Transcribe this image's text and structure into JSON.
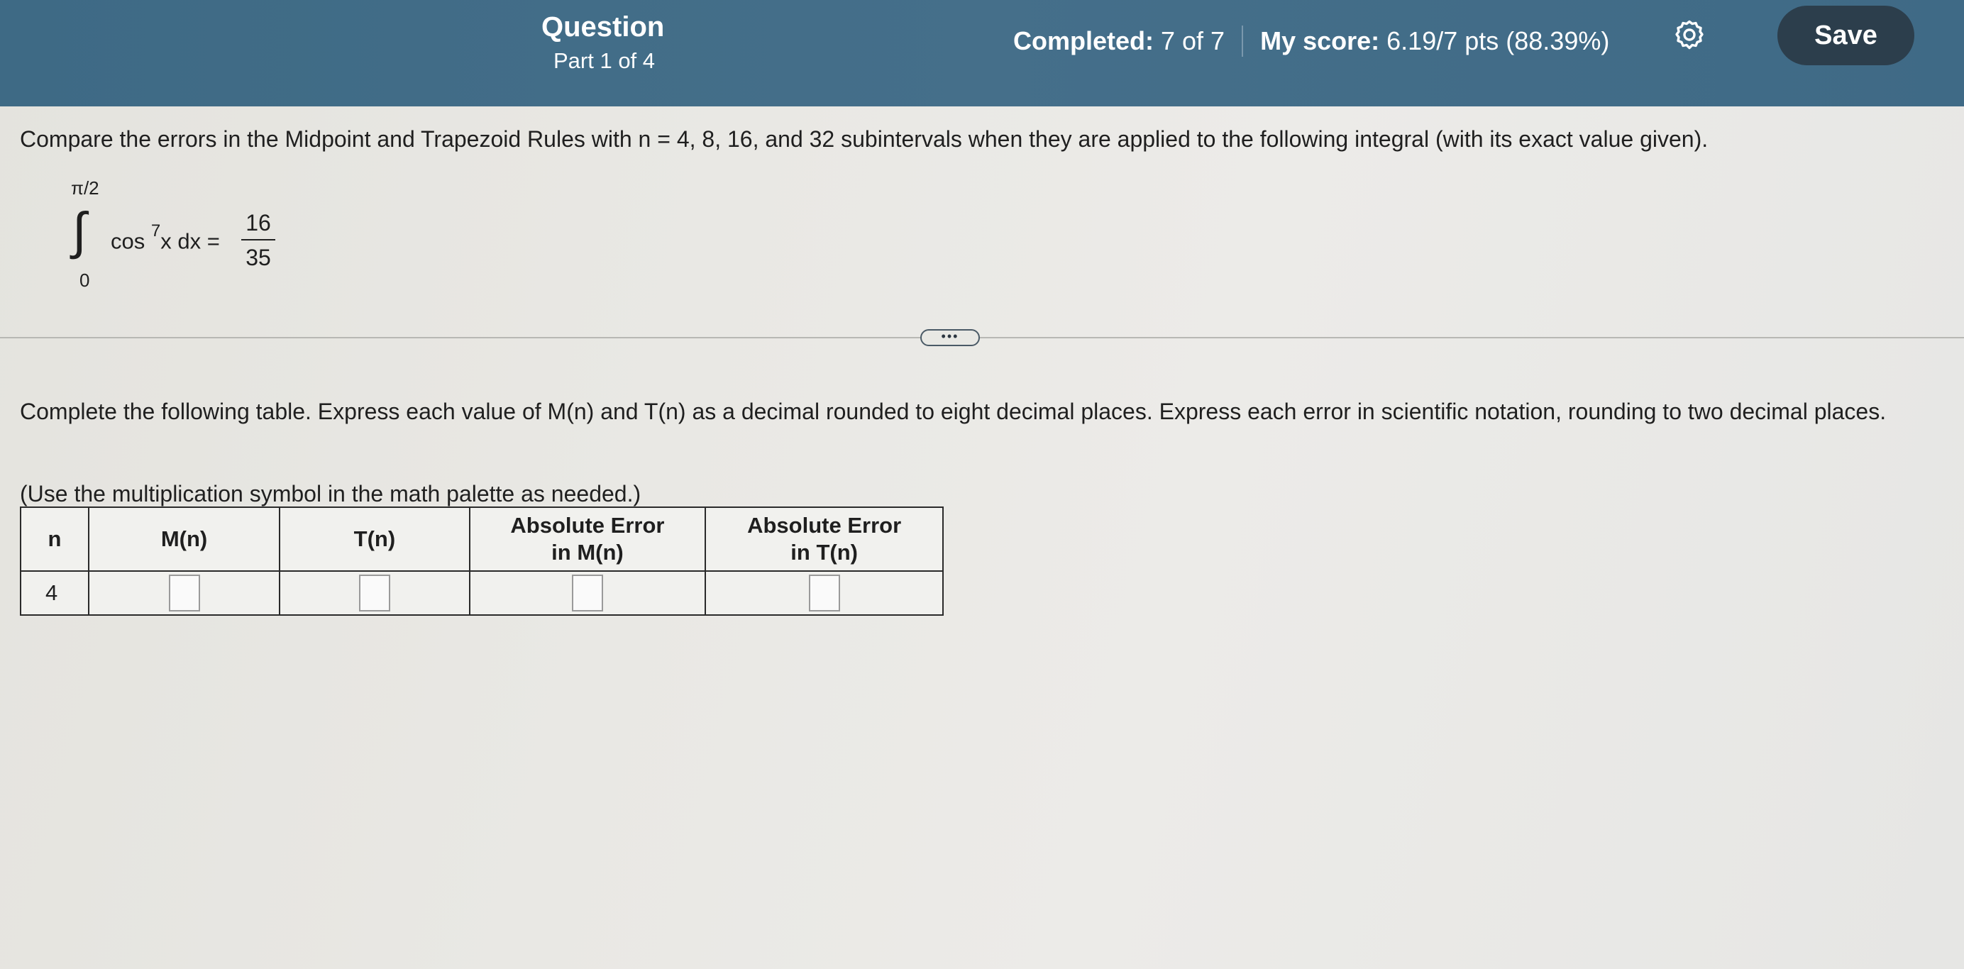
{
  "header": {
    "title": "Question",
    "part": "Part 1 of 4",
    "completed_label": "Completed:",
    "completed_value": "7 of 7",
    "score_label": "My score:",
    "score_value": "6.19/7 pts (88.39%)",
    "save_label": "Save",
    "settings_icon": "gear-icon"
  },
  "question": {
    "prompt": "Compare the errors in the Midpoint and Trapezoid Rules with n = 4, 8, 16, and 32 subintervals when they are applied to the following integral (with its exact value given).",
    "integral": {
      "upper": "π/2",
      "lower": "0",
      "function": "cos",
      "exponent": "7",
      "variable": "x dx =",
      "numerator": "16",
      "denominator": "35"
    },
    "more_label": "•••",
    "instruction": "Complete the following table. Express each value of M(n) and T(n) as a decimal rounded to eight decimal places. Express each error in scientific notation, rounding to two decimal places.",
    "hint": "(Use the multiplication symbol in the math palette as needed.)"
  },
  "table": {
    "headers": [
      "n",
      "M(n)",
      "T(n)",
      "Absolute Error in M(n)",
      "Absolute Error in T(n)"
    ],
    "rows": [
      {
        "n": "4",
        "m": "",
        "t": "",
        "err_m": "",
        "err_t": ""
      }
    ]
  }
}
